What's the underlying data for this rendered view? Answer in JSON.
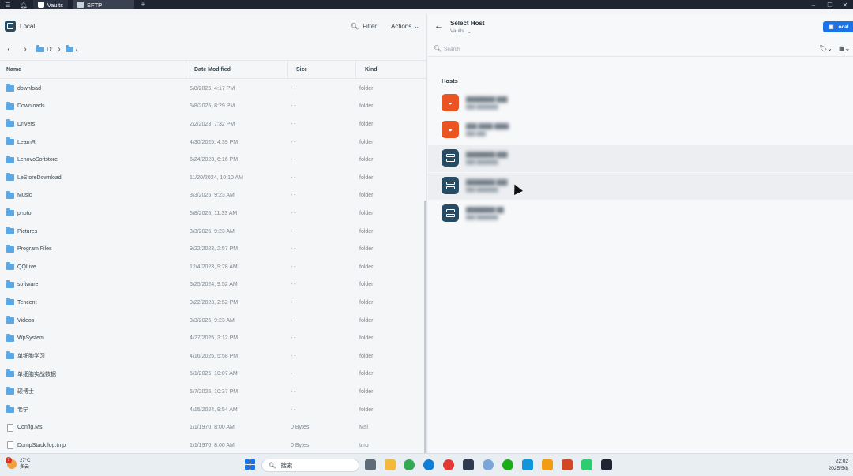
{
  "titlebar": {
    "tabs": [
      {
        "label": "Vaults"
      },
      {
        "label": "SFTP"
      }
    ]
  },
  "left": {
    "location_label": "Local",
    "filter_label": "Filter",
    "actions_label": "Actions",
    "path": {
      "drive": "D:",
      "separator": "/"
    },
    "columns": {
      "name": "Name",
      "date": "Date Modified",
      "size": "Size",
      "kind": "Kind"
    },
    "files": [
      {
        "name": "download",
        "date": "5/8/2025, 4:17 PM",
        "size": "- -",
        "kind": "folder",
        "type": "folder"
      },
      {
        "name": "Downloads",
        "date": "5/8/2025, 8:29 PM",
        "size": "- -",
        "kind": "folder",
        "type": "folder"
      },
      {
        "name": "Drivers",
        "date": "2/2/2023, 7:32 PM",
        "size": "- -",
        "kind": "folder",
        "type": "folder"
      },
      {
        "name": "LearnR",
        "date": "4/30/2025, 4:39 PM",
        "size": "- -",
        "kind": "folder",
        "type": "folder"
      },
      {
        "name": "LenovoSoftstore",
        "date": "6/24/2023, 6:16 PM",
        "size": "- -",
        "kind": "folder",
        "type": "folder"
      },
      {
        "name": "LeStoreDownload",
        "date": "11/20/2024, 10:10 AM",
        "size": "- -",
        "kind": "folder",
        "type": "folder"
      },
      {
        "name": "Music",
        "date": "3/3/2025, 9:23 AM",
        "size": "- -",
        "kind": "folder",
        "type": "folder"
      },
      {
        "name": "photo",
        "date": "5/8/2025, 11:33 AM",
        "size": "- -",
        "kind": "folder",
        "type": "folder"
      },
      {
        "name": "Pictures",
        "date": "3/3/2025, 9:23 AM",
        "size": "- -",
        "kind": "folder",
        "type": "folder"
      },
      {
        "name": "Program Files",
        "date": "9/22/2023, 2:57 PM",
        "size": "- -",
        "kind": "folder",
        "type": "folder"
      },
      {
        "name": "QQLive",
        "date": "12/4/2023, 9:28 AM",
        "size": "- -",
        "kind": "folder",
        "type": "folder"
      },
      {
        "name": "software",
        "date": "6/25/2024, 9:52 AM",
        "size": "- -",
        "kind": "folder",
        "type": "folder"
      },
      {
        "name": "Tencent",
        "date": "9/22/2023, 2:52 PM",
        "size": "- -",
        "kind": "folder",
        "type": "folder"
      },
      {
        "name": "Videos",
        "date": "3/3/2025, 9:23 AM",
        "size": "- -",
        "kind": "folder",
        "type": "folder"
      },
      {
        "name": "WpSystem",
        "date": "4/27/2025, 3:12 PM",
        "size": "- -",
        "kind": "folder",
        "type": "folder"
      },
      {
        "name": "单细胞学习",
        "date": "4/16/2025, 5:58 PM",
        "size": "- -",
        "kind": "folder",
        "type": "folder"
      },
      {
        "name": "单细胞实战数据",
        "date": "5/1/2025, 10:07 AM",
        "size": "- -",
        "kind": "folder",
        "type": "folder"
      },
      {
        "name": "硕博士",
        "date": "5/7/2025, 10:37 PM",
        "size": "- -",
        "kind": "folder",
        "type": "folder"
      },
      {
        "name": "老宁",
        "date": "4/15/2024, 9:54 AM",
        "size": "- -",
        "kind": "folder",
        "type": "folder"
      },
      {
        "name": "Config.Msi",
        "date": "1/1/1970, 8:00 AM",
        "size": "0 Bytes",
        "kind": "Msi",
        "type": "file"
      },
      {
        "name": "DumpStack.log.tmp",
        "date": "1/1/1970, 8:00 AM",
        "size": "0 Bytes",
        "kind": "tmp",
        "type": "file"
      }
    ]
  },
  "right": {
    "title": "Select Host",
    "subtitle": "Vaults",
    "local_button": "Local",
    "search_placeholder": "Search",
    "hosts_label": "Hosts",
    "hosts": [
      {
        "icon": "ubuntu-icon",
        "name": "████████ ███",
        "addr": "███ ███████"
      },
      {
        "icon": "ubuntu-icon",
        "name": "███ ████ ████",
        "addr": "███ ███"
      },
      {
        "icon": "server-icon",
        "name": "████████ ███",
        "addr": "███ ███████"
      },
      {
        "icon": "server-icon",
        "name": "████████ ███",
        "addr": "███ ███████"
      },
      {
        "icon": "server-icon",
        "name": "████████ ██",
        "addr": "███ ███████"
      }
    ]
  },
  "taskbar": {
    "weather_badge": "7",
    "temperature": "27°C",
    "condition": "多云",
    "search_label": "搜索",
    "time": "22:02",
    "date": "2025/5/8"
  },
  "colors": {
    "accent": "#1a73e8",
    "folder": "#5aa9e6",
    "ubuntu": "#e95420",
    "server": "#264b63",
    "titlebar": "#1e2431"
  }
}
